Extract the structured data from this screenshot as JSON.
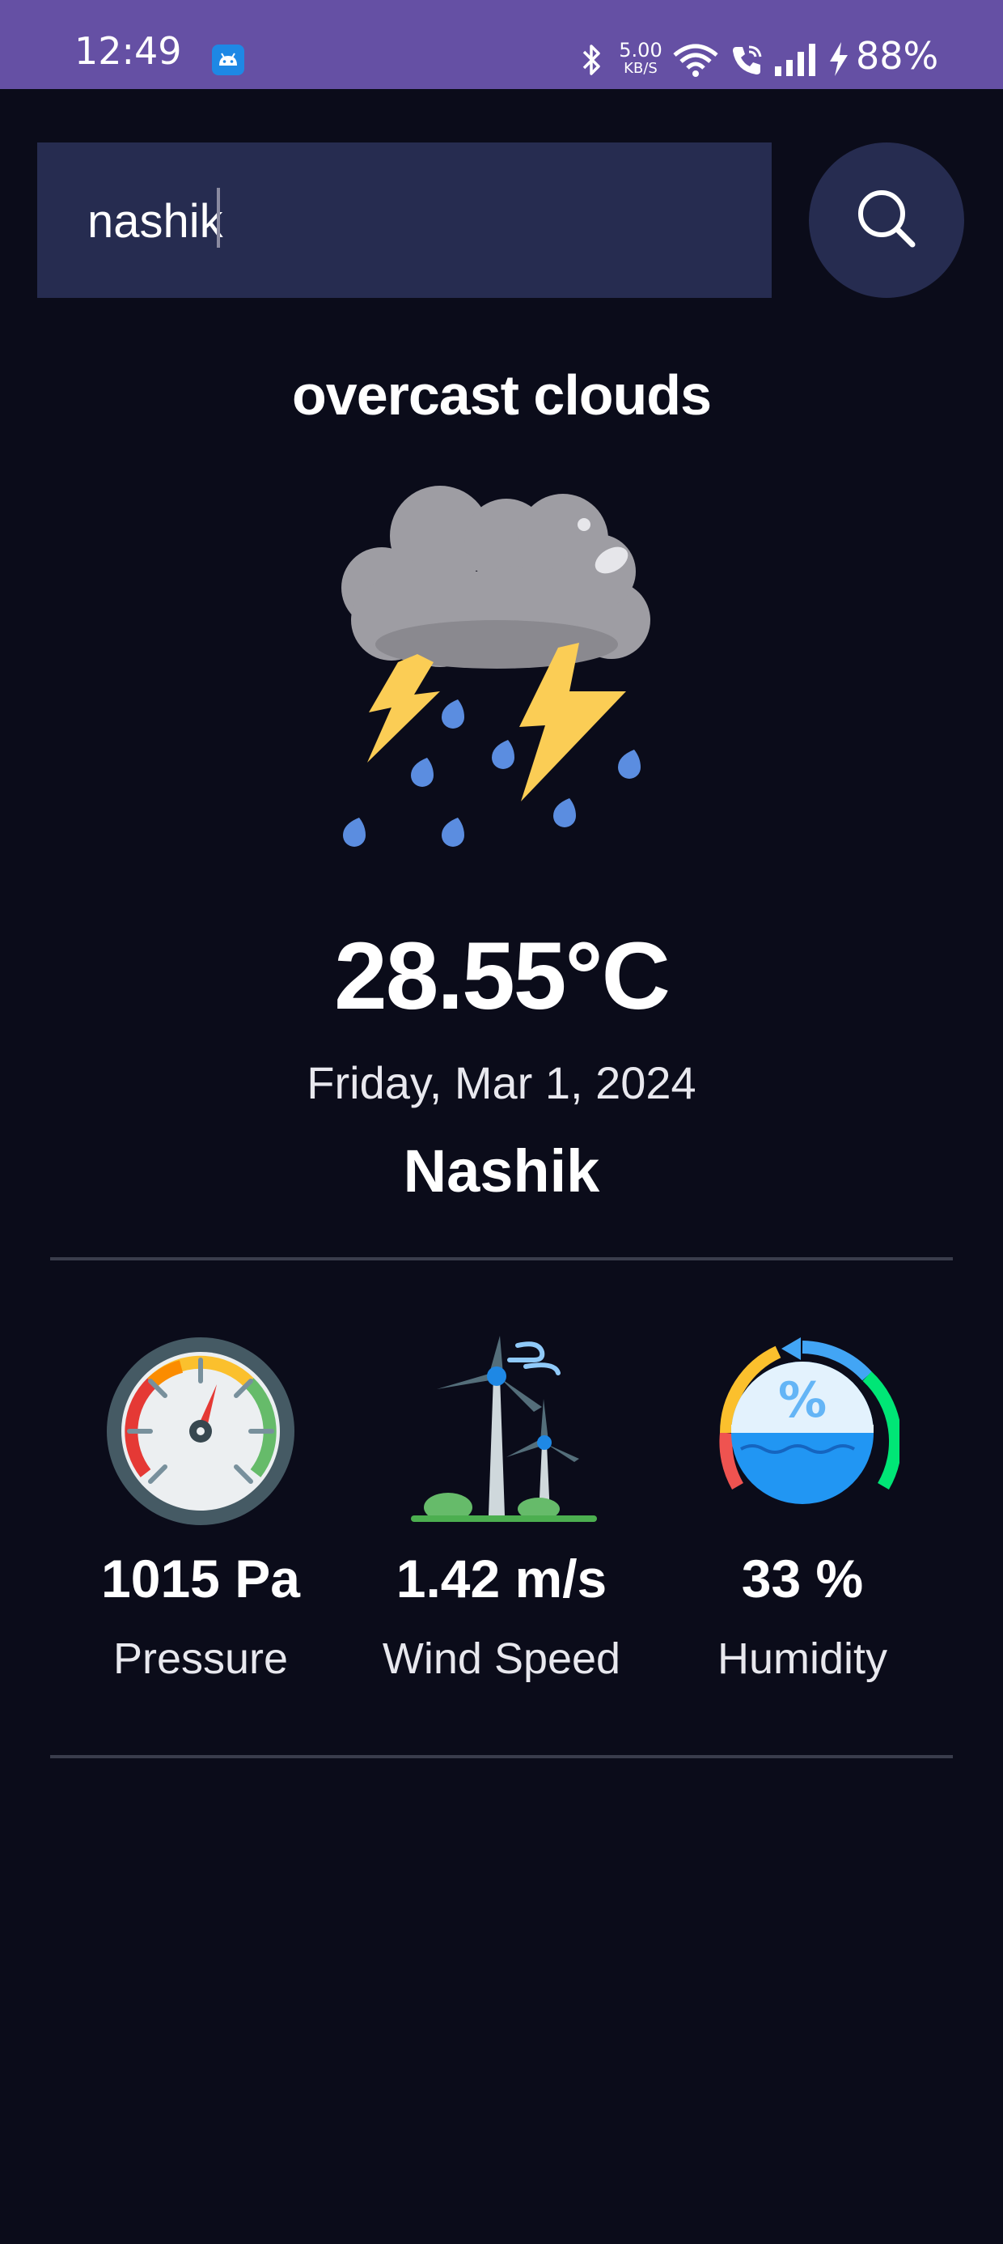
{
  "status_bar": {
    "time": "12:49",
    "net_speed_value": "5.00",
    "net_speed_unit": "KB/S",
    "battery": "88%",
    "icons": [
      "android-app-icon",
      "bluetooth-icon",
      "wifi-icon",
      "wifi-calling-icon",
      "signal-icon",
      "charging-icon"
    ]
  },
  "search": {
    "value": "nashik",
    "icon": "search-icon"
  },
  "weather": {
    "description": "overcast clouds",
    "icon": "thunderstorm-rain-icon",
    "temperature": "28.55°C",
    "date": "Friday, Mar 1, 2024",
    "city": "Nashik"
  },
  "stats": [
    {
      "icon": "pressure-gauge-icon",
      "value": "1015 Pa",
      "label": "Pressure"
    },
    {
      "icon": "wind-turbine-icon",
      "value": "1.42 m/s",
      "label": "Wind Speed"
    },
    {
      "icon": "humidity-icon",
      "value": "33 %",
      "label": "Humidity"
    }
  ],
  "colors": {
    "status_bar": "#6550a4",
    "background": "#0b0c1a",
    "search_field": "#262c50"
  }
}
